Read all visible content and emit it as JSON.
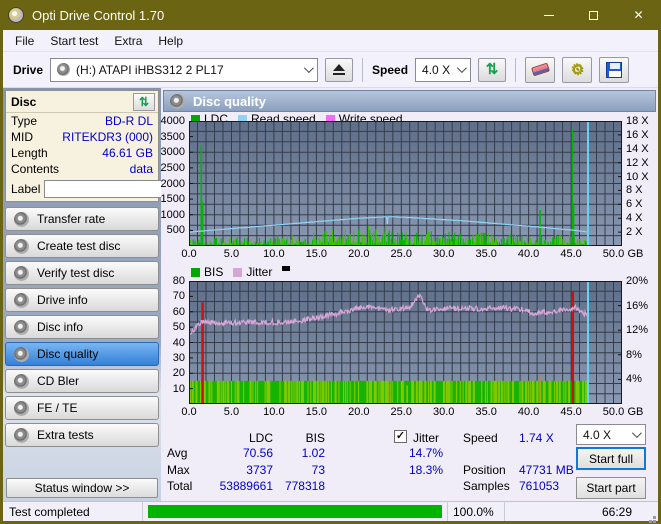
{
  "window": {
    "title": "Opti Drive Control 1.70"
  },
  "menu": {
    "items": [
      "File",
      "Start test",
      "Extra",
      "Help"
    ]
  },
  "toolbar": {
    "drive_label": "Drive",
    "drive_value": "(H:)   ATAPI iHBS312   2 PL17",
    "speed_label": "Speed",
    "speed_value": "4.0 X"
  },
  "sidebar": {
    "panel_title": "Disc",
    "fields": [
      {
        "label": "Type",
        "value": "BD-R DL"
      },
      {
        "label": "MID",
        "value": "RITEKDR3 (000)"
      },
      {
        "label": "Length",
        "value": "46.61 GB"
      },
      {
        "label": "Contents",
        "value": "data"
      }
    ],
    "label_label": "Label",
    "label_value": "",
    "buttons": [
      {
        "label": "Transfer rate",
        "icon": "transfer-rate-icon"
      },
      {
        "label": "Create test disc",
        "icon": "create-test-disc-icon"
      },
      {
        "label": "Verify test disc",
        "icon": "verify-test-disc-icon"
      },
      {
        "label": "Drive info",
        "icon": "drive-info-icon"
      },
      {
        "label": "Disc info",
        "icon": "disc-info-icon"
      },
      {
        "label": "Disc quality",
        "icon": "disc-quality-icon"
      },
      {
        "label": "CD Bler",
        "icon": "cd-bler-icon"
      },
      {
        "label": "FE / TE",
        "icon": "fe-te-icon"
      },
      {
        "label": "Extra tests",
        "icon": "extra-tests-icon"
      }
    ],
    "selected_index": 5,
    "status_window_label": "Status window >>"
  },
  "main": {
    "header_title": "Disc quality"
  },
  "chart_data": [
    {
      "type": "bar",
      "name": "disc-quality-ldc",
      "legend": [
        {
          "label": "LDC",
          "color": "#00a800"
        },
        {
          "label": "Read speed",
          "color": "#8fd4f4"
        },
        {
          "label": "Write speed",
          "color": "#f56af5"
        }
      ],
      "x_axis": {
        "ticks": [
          0,
          5,
          10,
          15,
          20,
          25,
          30,
          35,
          40,
          45,
          50
        ],
        "unit": "GB",
        "max": 51
      },
      "y_left": {
        "max": 4000,
        "ticks": [
          4000,
          3500,
          3000,
          2500,
          2000,
          1500,
          1000,
          500
        ],
        "suffix": ""
      },
      "y_right": {
        "max": 18,
        "ticks": [
          18,
          16,
          14,
          12,
          10,
          8,
          6,
          4,
          2
        ],
        "suffix": " X"
      },
      "data_end": 46.8,
      "bars": {
        "color": "#00b400",
        "color2": "#3cc300",
        "scale_max": 4000,
        "profile": [
          [
            0,
            260
          ],
          [
            4,
            280
          ],
          [
            8,
            310
          ],
          [
            12,
            370
          ],
          [
            15,
            470
          ],
          [
            17,
            560
          ],
          [
            19,
            630
          ],
          [
            21,
            660
          ],
          [
            23,
            680
          ],
          [
            24,
            580
          ],
          [
            26,
            510
          ],
          [
            28,
            480
          ],
          [
            30,
            460
          ],
          [
            33,
            440
          ],
          [
            36,
            430
          ],
          [
            39,
            410
          ],
          [
            41,
            430
          ],
          [
            43,
            390
          ],
          [
            45,
            410
          ],
          [
            46.8,
            390
          ]
        ]
      },
      "bar_spikes": [
        [
          1.45,
          3200,
          "#00b400"
        ],
        [
          1.6,
          1400,
          "#00b400"
        ],
        [
          41.35,
          1150,
          "#00b400"
        ],
        [
          45.15,
          3737,
          "#00b400"
        ],
        [
          45.3,
          1300,
          "#00b400"
        ]
      ],
      "line": {
        "color": "#8fd4f4",
        "scale_max": 18,
        "quantize": 0.05,
        "noise": 0,
        "points": [
          [
            0,
            2.0
          ],
          [
            2,
            2.2
          ],
          [
            4,
            2.4
          ],
          [
            6,
            2.6
          ],
          [
            8,
            2.8
          ],
          [
            10,
            3.0
          ],
          [
            12,
            3.2
          ],
          [
            14,
            3.4
          ],
          [
            16,
            3.6
          ],
          [
            18,
            3.8
          ],
          [
            20,
            4.0
          ],
          [
            22,
            4.12
          ],
          [
            23.2,
            4.2
          ],
          [
            23.3,
            4.2
          ],
          [
            23.35,
            3.05
          ],
          [
            23.45,
            4.2
          ],
          [
            24,
            4.2
          ],
          [
            26,
            4.1
          ],
          [
            28,
            3.95
          ],
          [
            30,
            3.8
          ],
          [
            32,
            3.65
          ],
          [
            34,
            3.45
          ],
          [
            36,
            3.25
          ],
          [
            38,
            3.05
          ],
          [
            40,
            2.85
          ],
          [
            42,
            2.65
          ],
          [
            44,
            2.4
          ],
          [
            45.5,
            2.25
          ],
          [
            46.8,
            2.05
          ]
        ]
      },
      "end_vline": {
        "x": 47,
        "color": "#66d2f5"
      }
    },
    {
      "type": "bar",
      "name": "disc-quality-bis-jitter",
      "legend": [
        {
          "label": "BIS",
          "color": "#00a800"
        },
        {
          "label": "Jitter",
          "color": "#d7a6d7"
        },
        {
          "label": "",
          "color": "#000000",
          "raised": true
        }
      ],
      "x_axis": {
        "ticks": [
          0,
          5,
          10,
          15,
          20,
          25,
          30,
          35,
          40,
          45,
          50
        ],
        "unit": "GB",
        "max": 51
      },
      "y_left": {
        "max": 80,
        "ticks": [
          80,
          70,
          60,
          50,
          40,
          30,
          20,
          10
        ],
        "suffix": ""
      },
      "y_right": {
        "max": 20,
        "ticks": [
          20,
          16,
          12,
          8,
          4
        ],
        "suffix": "%"
      },
      "data_end": 46.8,
      "bars": {
        "color": "#16b400",
        "color2": "#7fc900",
        "scale_max": 80,
        "profile": [
          [
            0,
            6.5
          ],
          [
            5,
            6.5
          ],
          [
            10,
            7
          ],
          [
            14,
            7.5
          ],
          [
            16,
            8.5
          ],
          [
            18,
            9.5
          ],
          [
            20,
            10.5
          ],
          [
            21.5,
            12
          ],
          [
            23,
            11
          ],
          [
            24,
            9.5
          ],
          [
            26,
            8.5
          ],
          [
            28,
            7.5
          ],
          [
            30,
            7
          ],
          [
            35,
            7
          ],
          [
            40,
            7
          ],
          [
            43,
            6.5
          ],
          [
            46.8,
            6.5
          ]
        ]
      },
      "bar_spikes": [
        [
          23.4,
          14,
          "#a8b400"
        ],
        [
          25.7,
          12,
          "#a8b400"
        ],
        [
          41.3,
          18,
          "#c98c00"
        ],
        [
          1.6,
          66,
          "#cf1010"
        ],
        [
          45.2,
          73,
          "#cf1010"
        ]
      ],
      "line": {
        "color": "#d7a6d7",
        "scale_max": 80,
        "quantize": 0,
        "noise": 1.7,
        "points": [
          [
            0,
            45
          ],
          [
            0.4,
            47
          ],
          [
            1,
            51
          ],
          [
            1.5,
            53
          ],
          [
            2,
            53
          ],
          [
            4,
            52.8
          ],
          [
            6,
            53
          ],
          [
            8,
            53.2
          ],
          [
            10,
            53.2
          ],
          [
            12,
            53.5
          ],
          [
            13,
            54
          ],
          [
            14,
            55
          ],
          [
            15,
            56
          ],
          [
            16,
            57.5
          ],
          [
            17,
            58
          ],
          [
            18,
            60
          ],
          [
            19,
            61
          ],
          [
            20,
            62.5
          ],
          [
            21,
            63.5
          ],
          [
            22,
            63
          ],
          [
            23,
            61
          ],
          [
            23.5,
            60
          ],
          [
            24,
            62
          ],
          [
            25,
            62
          ],
          [
            26,
            63
          ],
          [
            26.8,
            68
          ],
          [
            27.2,
            71
          ],
          [
            27.6,
            65
          ],
          [
            28,
            61.5
          ],
          [
            29,
            61
          ],
          [
            30,
            62
          ],
          [
            31,
            62.5
          ],
          [
            32,
            62
          ],
          [
            33,
            62.5
          ],
          [
            34,
            62
          ],
          [
            35,
            62.5
          ],
          [
            36,
            62
          ],
          [
            37,
            62.5
          ],
          [
            38,
            62
          ],
          [
            39,
            62
          ],
          [
            40,
            60
          ],
          [
            40.5,
            59
          ],
          [
            41,
            59.5
          ],
          [
            42,
            60
          ],
          [
            43,
            60.5
          ],
          [
            44,
            61
          ],
          [
            44.5,
            61.5
          ],
          [
            45,
            62
          ],
          [
            45.5,
            63
          ],
          [
            46,
            61
          ],
          [
            46.5,
            59
          ],
          [
            46.9,
            58.5
          ]
        ]
      },
      "end_vline": {
        "x": 47,
        "color": "#66d2f5"
      }
    }
  ],
  "stats": {
    "headers": {
      "ldc": "LDC",
      "bis": "BIS",
      "jitter": "Jitter"
    },
    "jitter_checked": true,
    "rows": [
      {
        "label": "Avg",
        "ldc": "70.56",
        "bis": "1.02",
        "jitter": "14.7%"
      },
      {
        "label": "Max",
        "ldc": "3737",
        "bis": "73",
        "jitter": "18.3%"
      },
      {
        "label": "Total",
        "ldc": "53889661",
        "bis": "778318",
        "jitter": ""
      }
    ],
    "info": [
      {
        "label": "Speed",
        "value": "1.74 X"
      },
      {
        "label": "Position",
        "value": "47731 MB"
      },
      {
        "label": "Samples",
        "value": "761053"
      }
    ]
  },
  "controls": {
    "speed_select": "4.0 X",
    "start_full": "Start full",
    "start_part": "Start part"
  },
  "statusbar": {
    "status": "Test completed",
    "progress": "100.0%",
    "progress_value": 100,
    "time": "66:29"
  }
}
